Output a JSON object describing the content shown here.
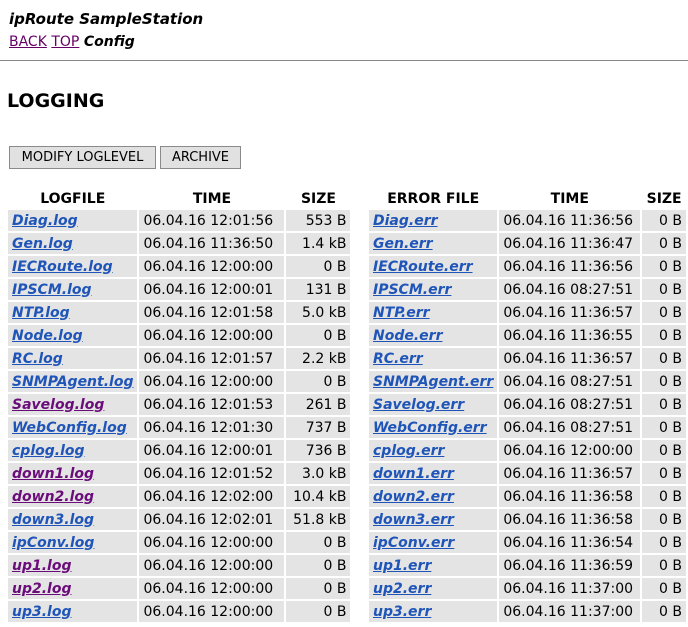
{
  "header": {
    "title": "ipRoute SampleStation"
  },
  "nav": {
    "back": "BACK",
    "top": "TOP",
    "current": "Config"
  },
  "page": {
    "heading": "LOGGING"
  },
  "buttons": {
    "modify": "MODIFY LOGLEVEL",
    "archive": "ARCHIVE"
  },
  "colors": {
    "link": "#1f55b8",
    "visited": "#6a0c7a",
    "cell_bg": "#e4e4e4"
  },
  "logs": {
    "headers": [
      "LOGFILE",
      "TIME",
      "SIZE"
    ],
    "rows": [
      {
        "name": "Diag.log",
        "time": "06.04.16 12:01:56",
        "size": "553 B",
        "visited": false
      },
      {
        "name": "Gen.log",
        "time": "06.04.16 11:36:50",
        "size": "1.4 kB",
        "visited": false
      },
      {
        "name": "IECRoute.log",
        "time": "06.04.16 12:00:00",
        "size": "0 B",
        "visited": false
      },
      {
        "name": "IPSCM.log",
        "time": "06.04.16 12:00:01",
        "size": "131 B",
        "visited": false
      },
      {
        "name": "NTP.log",
        "time": "06.04.16 12:01:58",
        "size": "5.0 kB",
        "visited": false
      },
      {
        "name": "Node.log",
        "time": "06.04.16 12:00:00",
        "size": "0 B",
        "visited": false
      },
      {
        "name": "RC.log",
        "time": "06.04.16 12:01:57",
        "size": "2.2 kB",
        "visited": false
      },
      {
        "name": "SNMPAgent.log",
        "time": "06.04.16 12:00:00",
        "size": "0 B",
        "visited": false
      },
      {
        "name": "Savelog.log",
        "time": "06.04.16 12:01:53",
        "size": "261 B",
        "visited": true
      },
      {
        "name": "WebConfig.log",
        "time": "06.04.16 12:01:30",
        "size": "737 B",
        "visited": false
      },
      {
        "name": "cplog.log",
        "time": "06.04.16 12:00:01",
        "size": "736 B",
        "visited": false
      },
      {
        "name": "down1.log",
        "time": "06.04.16 12:01:52",
        "size": "3.0 kB",
        "visited": true
      },
      {
        "name": "down2.log",
        "time": "06.04.16 12:02:00",
        "size": "10.4 kB",
        "visited": true
      },
      {
        "name": "down3.log",
        "time": "06.04.16 12:02:01",
        "size": "51.8 kB",
        "visited": false
      },
      {
        "name": "ipConv.log",
        "time": "06.04.16 12:00:00",
        "size": "0 B",
        "visited": false
      },
      {
        "name": "up1.log",
        "time": "06.04.16 12:00:00",
        "size": "0 B",
        "visited": true
      },
      {
        "name": "up2.log",
        "time": "06.04.16 12:00:00",
        "size": "0 B",
        "visited": true
      },
      {
        "name": "up3.log",
        "time": "06.04.16 12:00:00",
        "size": "0 B",
        "visited": false
      }
    ]
  },
  "errors": {
    "headers": [
      "ERROR FILE",
      "TIME",
      "SIZE"
    ],
    "rows": [
      {
        "name": "Diag.err",
        "time": "06.04.16 11:36:56",
        "size": "0 B"
      },
      {
        "name": "Gen.err",
        "time": "06.04.16 11:36:47",
        "size": "0 B"
      },
      {
        "name": "IECRoute.err",
        "time": "06.04.16 11:36:56",
        "size": "0 B"
      },
      {
        "name": "IPSCM.err",
        "time": "06.04.16 08:27:51",
        "size": "0 B"
      },
      {
        "name": "NTP.err",
        "time": "06.04.16 11:36:57",
        "size": "0 B"
      },
      {
        "name": "Node.err",
        "time": "06.04.16 11:36:55",
        "size": "0 B"
      },
      {
        "name": "RC.err",
        "time": "06.04.16 11:36:57",
        "size": "0 B"
      },
      {
        "name": "SNMPAgent.err",
        "time": "06.04.16 08:27:51",
        "size": "0 B"
      },
      {
        "name": "Savelog.err",
        "time": "06.04.16 08:27:51",
        "size": "0 B"
      },
      {
        "name": "WebConfig.err",
        "time": "06.04.16 08:27:51",
        "size": "0 B"
      },
      {
        "name": "cplog.err",
        "time": "06.04.16 12:00:00",
        "size": "0 B"
      },
      {
        "name": "down1.err",
        "time": "06.04.16 11:36:57",
        "size": "0 B"
      },
      {
        "name": "down2.err",
        "time": "06.04.16 11:36:58",
        "size": "0 B"
      },
      {
        "name": "down3.err",
        "time": "06.04.16 11:36:58",
        "size": "0 B"
      },
      {
        "name": "ipConv.err",
        "time": "06.04.16 11:36:54",
        "size": "0 B"
      },
      {
        "name": "up1.err",
        "time": "06.04.16 11:36:59",
        "size": "0 B"
      },
      {
        "name": "up2.err",
        "time": "06.04.16 11:37:00",
        "size": "0 B"
      },
      {
        "name": "up3.err",
        "time": "06.04.16 11:37:00",
        "size": "0 B"
      }
    ]
  }
}
